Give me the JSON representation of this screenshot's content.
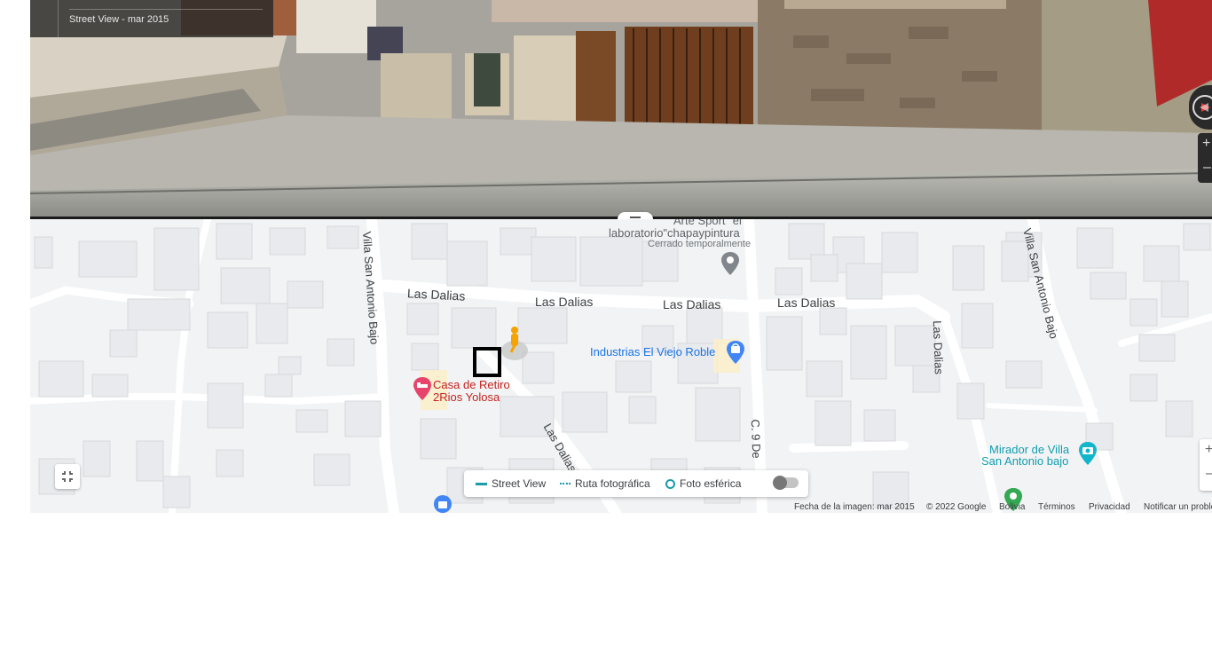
{
  "street_view": {
    "label": "Street View - mar 2015"
  },
  "map": {
    "streets": [
      {
        "id": "las-dalias-1",
        "text": "Las Dalias"
      },
      {
        "id": "las-dalias-2",
        "text": "Las Dalias"
      },
      {
        "id": "las-dalias-3",
        "text": "Las Dalias"
      },
      {
        "id": "las-dalias-4",
        "text": "Las Dalias"
      },
      {
        "id": "las-dalias-5",
        "text": "Las Dalias"
      },
      {
        "id": "las-dalias-6",
        "text": "Las Dalias"
      },
      {
        "id": "villa-san-antonio-1",
        "text": "Villa San Antonio Bajo"
      },
      {
        "id": "villa-san-antonio-2",
        "text": "Villa San Antonio Bajo"
      },
      {
        "id": "c9",
        "text": "C. 9 De"
      }
    ],
    "pois": {
      "arte_sport": {
        "line1": "Arte Sport \"el",
        "line2": "laboratorio\"chapaypintura",
        "status": "Cerrado temporalmente"
      },
      "industrias": {
        "name": "Industrias El Viejo Roble"
      },
      "casa_retiro": {
        "line1": "Casa de Retiro",
        "line2": "2Rios Yolosa"
      },
      "mirador": {
        "line1": "Mirador de Villa",
        "line2": "San Antonio bajo"
      }
    },
    "colors": {
      "shopping": "#4285f4",
      "lodging": "#e8446b",
      "attraction": "#12b5cb",
      "park": "#34a853",
      "pegman": "#f4a300"
    }
  },
  "legend": {
    "street_view": "Street View",
    "ruta": "Ruta fotográfica",
    "foto": "Foto esférica"
  },
  "footer": {
    "date": "Fecha de la imagen: mar 2015",
    "copyright": "© 2022 Google",
    "country": "Bolivia",
    "terms": "Términos",
    "privacy": "Privacidad",
    "report": "Notificar un problema"
  },
  "icons": [
    "compass-icon",
    "fullscreen-exit-icon",
    "pegman-icon",
    "location-pin-icon",
    "shopping-bag-icon",
    "bed-icon",
    "camera-icon",
    "park-icon",
    "zoom-in-icon",
    "zoom-out-icon"
  ]
}
